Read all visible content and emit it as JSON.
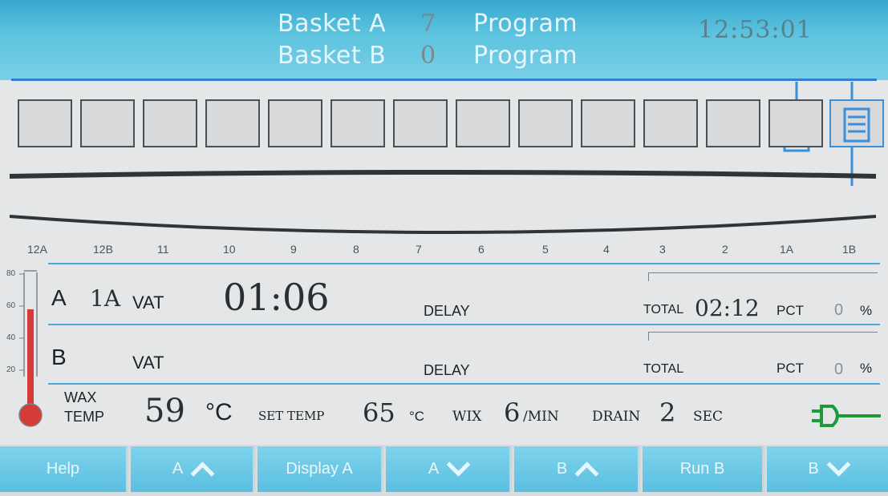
{
  "header": {
    "basket_a_label": "Basket A",
    "basket_a_num": "7",
    "basket_b_label": "Basket B",
    "basket_b_num": "0",
    "program_label_a": "Program",
    "program_label_b": "Program",
    "clock": "12:53:01"
  },
  "vats": {
    "labels": [
      "12A",
      "12B",
      "11",
      "10",
      "9",
      "8",
      "7",
      "6",
      "5",
      "4",
      "3",
      "2",
      "1A",
      "1B"
    ]
  },
  "panel": {
    "thermometer_ticks": [
      "80",
      "60",
      "40",
      "20"
    ],
    "row_a": {
      "id": "A",
      "vat_value": "1A",
      "vat_label": "VAT",
      "time": "01:06",
      "delay_label": "DELAY",
      "total_label": "TOTAL",
      "total_value": "02:12",
      "pct_label": "PCT",
      "pct_value": "0",
      "pct_unit": "%"
    },
    "row_b": {
      "id": "B",
      "vat_label": "VAT",
      "delay_label": "DELAY",
      "total_label": "TOTAL",
      "pct_label": "PCT",
      "pct_value": "0",
      "pct_unit": "%"
    },
    "wax": {
      "label_line1": "WAX",
      "label_line2": "TEMP",
      "temp_value": "59",
      "temp_unit": "°C",
      "set_temp_label": "SET TEMP",
      "set_temp_value": "65",
      "set_temp_unit": "°C",
      "wix_label": "WIX",
      "wix_value": "6",
      "wix_unit": "/MIN",
      "drain_label": "DRAIN",
      "drain_value": "2",
      "drain_unit": "SEC"
    }
  },
  "footer": {
    "buttons": [
      {
        "label": "Help"
      },
      {
        "label": "A",
        "icon": "chevron-up-icon"
      },
      {
        "label": "Display A"
      },
      {
        "label": "A",
        "icon": "chevron-down-icon"
      },
      {
        "label": "B",
        "icon": "chevron-up-icon"
      },
      {
        "label": "Run B"
      },
      {
        "label": "B",
        "icon": "chevron-down-icon"
      }
    ]
  },
  "colors": {
    "header_blue": "#5bc2de",
    "accent_line": "#2f7fd0",
    "button_blue": "#6cc9e6",
    "thermo_red": "#d43a3a"
  }
}
